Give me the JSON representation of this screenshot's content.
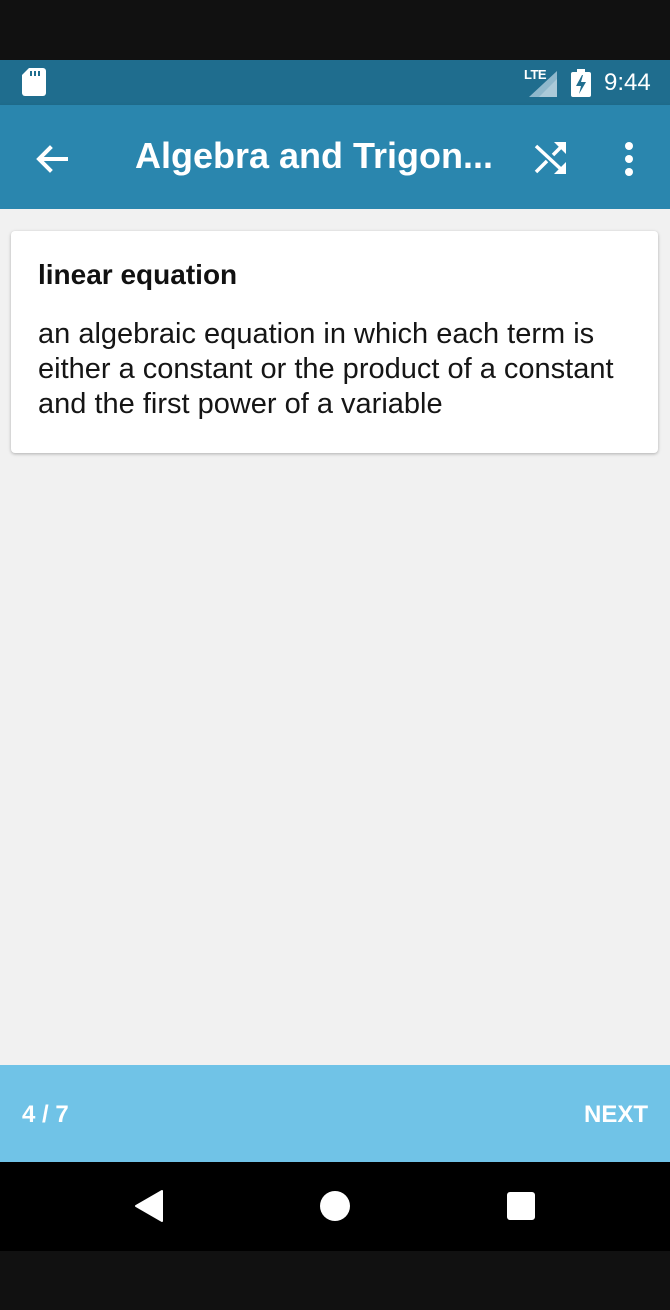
{
  "status_bar": {
    "network_label": "LTE",
    "time": "9:44",
    "icons": [
      "sd-card-icon",
      "signal-icon",
      "battery-charging-icon"
    ]
  },
  "app_bar": {
    "title": "Algebra and Trigon...",
    "icons": [
      "back-arrow-icon",
      "shuffle-icon",
      "more-vert-icon"
    ]
  },
  "card": {
    "term": "linear equation",
    "definition": "an algebraic equation in which each term is either a constant or the product of a constant and the first power of a variable"
  },
  "footer": {
    "counter": "4 / 7",
    "next_label": "NEXT"
  },
  "nav_bar": {
    "icons": [
      "nav-back-icon",
      "nav-home-icon",
      "nav-recents-icon"
    ]
  },
  "colors": {
    "status_bar": "#1f6d8e",
    "app_bar": "#2a86ae",
    "footer": "#70c3e7",
    "content_bg": "#f1f1f1"
  }
}
